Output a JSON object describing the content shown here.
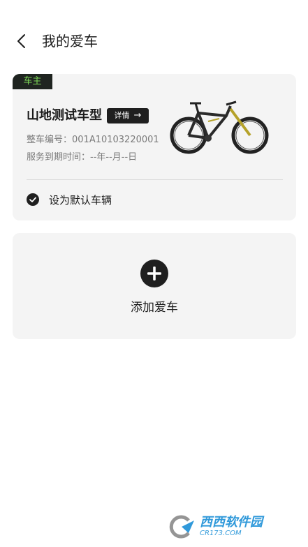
{
  "header": {
    "title": "我的爱车"
  },
  "vehicle_card": {
    "owner_tag": "车主",
    "model_name": "山地测试车型",
    "detail_button": "详情",
    "vin": "整车编号：001A10103220001",
    "service_expiry": "服务到期时间：--年--月--日",
    "default_option": "设为默认车辆",
    "default_selected": true
  },
  "add_card": {
    "label": "添加爱车"
  },
  "watermark": {
    "main": "西西软件园",
    "sub": "CR173.COM"
  },
  "colors": {
    "accent_green": "#7ed957",
    "tag_bg": "#1f2420",
    "card_bg": "#f4f4f4",
    "icon_dark": "#1f1f1f",
    "watermark_blue": "#1a8fd6"
  }
}
